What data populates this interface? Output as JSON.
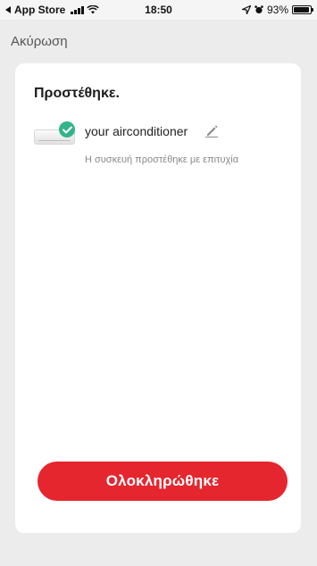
{
  "status_bar": {
    "back_app": "App Store",
    "time": "18:50",
    "battery": "93%"
  },
  "nav": {
    "cancel_label": "Ακύρωση"
  },
  "card": {
    "title": "Προστέθηκε.",
    "device": {
      "name": "your airconditioner",
      "status": "Η συσκευή προστέθηκε με επιτυχία",
      "icon": "airconditioner-icon",
      "badge_icon": "check-icon",
      "edit_icon": "pencil-icon"
    },
    "done_label": "Ολοκληρώθηκε"
  },
  "colors": {
    "accent": "#e5262f",
    "success": "#33b48b",
    "background": "#ececec",
    "card": "#ffffff"
  }
}
